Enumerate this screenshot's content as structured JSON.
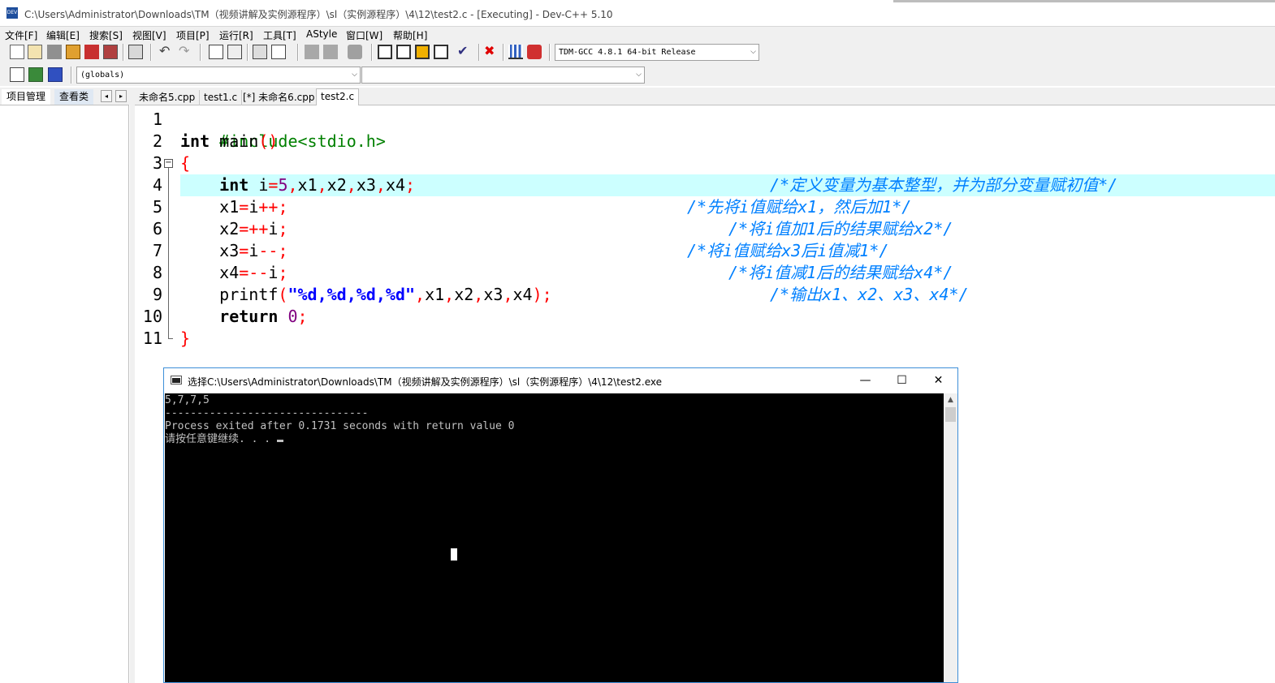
{
  "window": {
    "title": "C:\\Users\\Administrator\\Downloads\\TM（视频讲解及实例源程序）\\sl（实例源程序）\\4\\12\\test2.c - [Executing] - Dev-C++ 5.10",
    "icon": "dev-cpp-app-icon"
  },
  "menu": [
    "文件[F]",
    "编辑[E]",
    "搜索[S]",
    "视图[V]",
    "项目[P]",
    "运行[R]",
    "工具[T]",
    "AStyle",
    "窗口[W]",
    "帮助[H]"
  ],
  "toolbar": {
    "compiler_select": "TDM-GCC 4.8.1 64-bit Release",
    "scope_select": "(globals)",
    "function_select": ""
  },
  "left_panel": {
    "tabs": [
      "项目管理",
      "查看类"
    ],
    "scroll_left": "◂",
    "scroll_right": "▸"
  },
  "editor_tabs": [
    "未命名5.cpp",
    "test1.c",
    "[*] 未命名6.cpp",
    "test2.c"
  ],
  "code": {
    "line_numbers": [
      "1",
      "2",
      "3",
      "4",
      "5",
      "6",
      "7",
      "8",
      "9",
      "10",
      "11"
    ],
    "fold_symbol": "−",
    "l1": "#include<stdio.h>",
    "l2_kw": "int",
    "l2_rest": " main",
    "l2_paren": "()",
    "l3_brace": "{",
    "l4_kw": "int",
    "l4_a": " i",
    "l4_eq": "=",
    "l4_num": "5",
    "l4_c1": ",",
    "l4_x1": "x1",
    "l4_c2": ",",
    "l4_x2": "x2",
    "l4_c3": ",",
    "l4_x3": "x3",
    "l4_c4": ",",
    "l4_x4": "x4",
    "l4_semi": ";",
    "l4_comment": "/*定义变量为基本整型，并为部分变量赋初值*/",
    "l5_a": "x1",
    "l5_op": "=",
    "l5_b": "i",
    "l5_op2": "++;",
    "l5_comment": "/*先将i值赋给x1，然后加1*/",
    "l6_a": "x2",
    "l6_op": "=++",
    "l6_b": "i",
    "l6_semi": ";",
    "l6_comment": "/*将i值加1后的结果赋给x2*/",
    "l7_a": "x3",
    "l7_op": "=",
    "l7_b": "i",
    "l7_op2": "--;",
    "l7_comment": "/*将i值赋给x3后i值减1*/",
    "l8_a": "x4",
    "l8_op": "=--",
    "l8_b": "i",
    "l8_semi": ";",
    "l8_comment": "/*将i值减1后的结果赋给x4*/",
    "l9_fn": "printf",
    "l9_p1": "(",
    "l9_str": "\"%d,%d,%d,%d\"",
    "l9_c1": ",",
    "l9_x1": "x1",
    "l9_c2": ",",
    "l9_x2": "x2",
    "l9_c3": ",",
    "l9_x3": "x3",
    "l9_c4": ",",
    "l9_x4": "x4",
    "l9_end": ");",
    "l9_comment": "/*输出x1、x2、x3、x4*/",
    "l10_kw": "return",
    "l10_num": "0",
    "l10_semi": ";",
    "l11_brace": "}"
  },
  "console": {
    "title": "选择C:\\Users\\Administrator\\Downloads\\TM（视频讲解及实例源程序）\\sl（实例源程序）\\4\\12\\test2.exe",
    "minimize": "—",
    "maximize": "☐",
    "close": "✕",
    "output_line1": "5,7,7,5",
    "output_line2": "--------------------------------",
    "output_line3": "Process exited after 0.1731 seconds with return value 0",
    "output_line4": "请按任意键继续. . . ",
    "scroll_up": "▲"
  },
  "colors": {
    "current_line": "#ccffff",
    "keyword": "#000000",
    "preprocessor": "#008000",
    "operator": "#ff0000",
    "number": "#800080",
    "string": "#0000ff",
    "comment": "#0080ff",
    "console_bg": "#000000",
    "console_text": "#c0c0c0",
    "console_border": "#3e8fd8"
  }
}
